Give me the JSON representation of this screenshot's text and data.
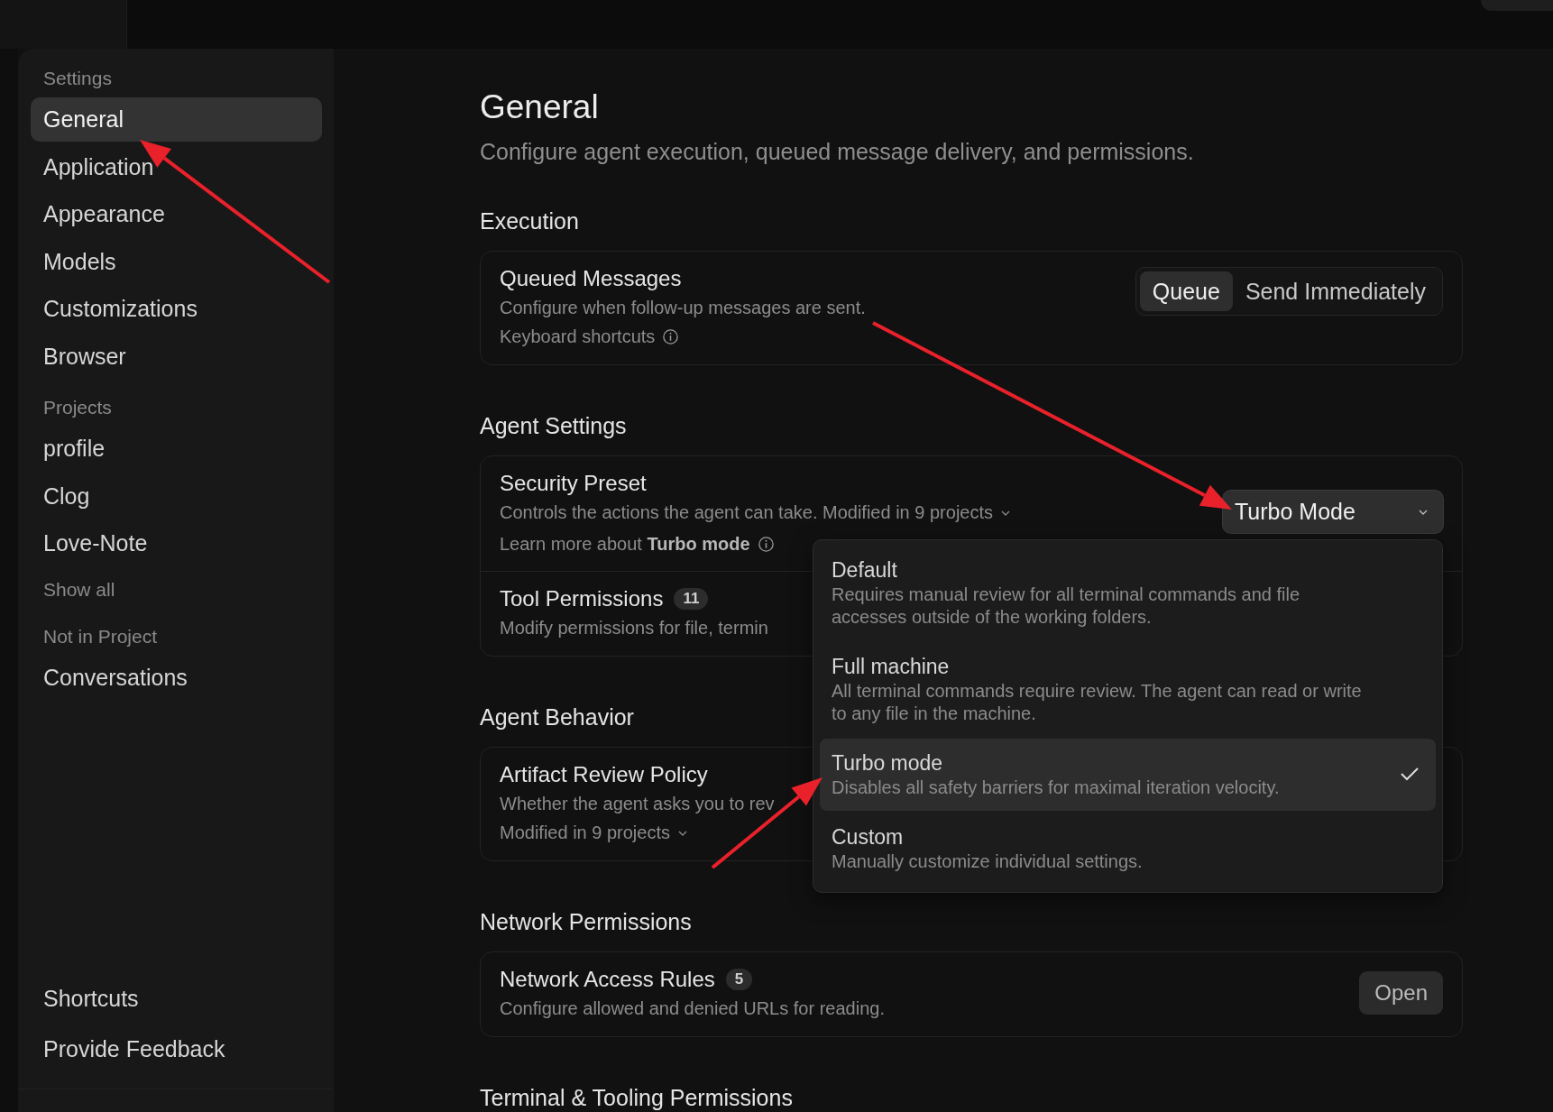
{
  "sidebar": {
    "groups": [
      {
        "label": "Settings",
        "items": [
          {
            "label": "General",
            "selected": true
          },
          {
            "label": "Application",
            "selected": false
          },
          {
            "label": "Appearance",
            "selected": false
          },
          {
            "label": "Models",
            "selected": false
          },
          {
            "label": "Customizations",
            "selected": false
          },
          {
            "label": "Browser",
            "selected": false
          }
        ]
      },
      {
        "label": "Projects",
        "items": [
          {
            "label": "profile",
            "selected": false
          },
          {
            "label": "Clog",
            "selected": false
          },
          {
            "label": "Love-Note",
            "selected": false
          }
        ],
        "more": "Show all"
      },
      {
        "label": "Not in Project",
        "items": [
          {
            "label": "Conversations",
            "selected": false
          }
        ]
      }
    ],
    "footer": [
      {
        "label": "Shortcuts"
      },
      {
        "label": "Provide Feedback"
      }
    ]
  },
  "page": {
    "title": "General",
    "subtitle": "Configure agent execution, queued message delivery, and permissions."
  },
  "sections": [
    {
      "heading": "Execution",
      "rows": [
        {
          "kind": "segmented",
          "title": "Queued Messages",
          "description": "Configure when follow-up messages are sent.",
          "link": "Keyboard shortcuts",
          "options": [
            {
              "label": "Queue",
              "selected": true
            },
            {
              "label": "Send Immediately",
              "selected": false
            }
          ]
        }
      ]
    },
    {
      "heading": "Agent Settings",
      "rows": [
        {
          "kind": "select",
          "title": "Security Preset",
          "description": "Controls the actions the agent can take.",
          "modified": "Modified in 9 projects",
          "learn_more": "Learn more about **Turbo mode**",
          "value": "Turbo Mode",
          "expanded": true,
          "options": [
            {
              "label": "Default",
              "description": "Requires manual review for all terminal commands and file accesses outside of the working folders.",
              "selected": false
            },
            {
              "label": "Full machine",
              "description": "All terminal commands require review. The agent can read or write to any file in the machine.",
              "selected": false
            },
            {
              "label": "Turbo mode",
              "description": "Disables all safety barriers for maximal iteration velocity.",
              "selected": true
            },
            {
              "label": "Custom",
              "description": "Manually customize individual settings.",
              "selected": false
            }
          ]
        },
        {
          "kind": "plain",
          "title": "Tool Permissions",
          "badge": "11",
          "description": "Modify permissions for file, termin"
        }
      ]
    },
    {
      "heading": "Agent Behavior",
      "rows": [
        {
          "kind": "plain",
          "title": "Artifact Review Policy",
          "description": "Whether the agent asks you to rev",
          "modified": "Modified in 9 projects"
        }
      ]
    },
    {
      "heading": "Network Permissions",
      "rows": [
        {
          "kind": "button",
          "title": "Network Access Rules",
          "badge": "5",
          "description": "Configure allowed and denied URLs for reading.",
          "button": "Open"
        }
      ]
    },
    {
      "heading": "Terminal & Tooling Permissions"
    }
  ]
}
